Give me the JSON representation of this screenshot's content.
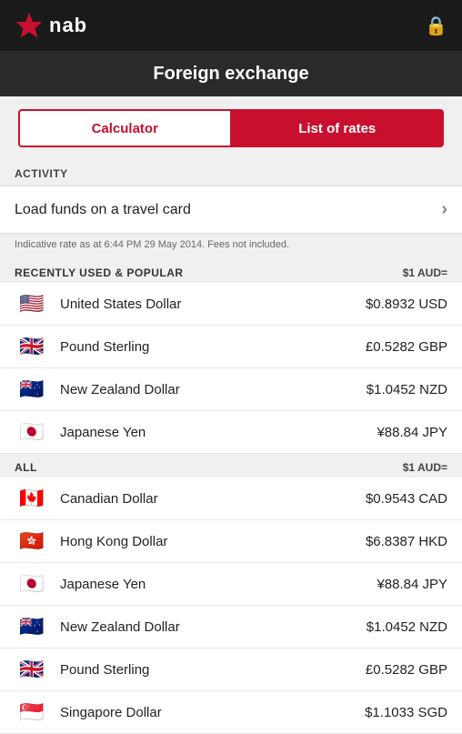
{
  "header": {
    "logo_text": "nab",
    "lock_icon": "🔒"
  },
  "title_bar": {
    "title": "Foreign exchange"
  },
  "tabs": {
    "calculator_label": "Calculator",
    "list_of_rates_label": "List of rates"
  },
  "activity": {
    "section_label": "ACTIVITY",
    "row_text": "Load funds on a travel card"
  },
  "indicative_note": "Indicative rate as at 6:44 PM 29 May 2014. Fees not included.",
  "recently_used": {
    "section_title": "RECENTLY USED & POPULAR",
    "rate_label": "$1 AUD=",
    "currencies": [
      {
        "flag": "🇺🇸",
        "name": "United States Dollar",
        "value": "$0.8932  USD"
      },
      {
        "flag": "🇬🇧",
        "name": "Pound Sterling",
        "value": "£0.5282  GBP"
      },
      {
        "flag": "🇳🇿",
        "name": "New Zealand Dollar",
        "value": "$1.0452  NZD"
      },
      {
        "flag": "🇯🇵",
        "name": "Japanese Yen",
        "value": "¥88.84  JPY"
      }
    ]
  },
  "all": {
    "section_title": "ALL",
    "rate_label": "$1 AUD=",
    "currencies": [
      {
        "flag": "🇨🇦",
        "name": "Canadian Dollar",
        "value": "$0.9543  CAD"
      },
      {
        "flag": "🇭🇰",
        "name": "Hong Kong Dollar",
        "value": "$6.8387  HKD"
      },
      {
        "flag": "🇯🇵",
        "name": "Japanese Yen",
        "value": "¥88.84  JPY"
      },
      {
        "flag": "🇳🇿",
        "name": "New Zealand Dollar",
        "value": "$1.0452  NZD"
      },
      {
        "flag": "🇬🇧",
        "name": "Pound Sterling",
        "value": "£0.5282  GBP"
      },
      {
        "flag": "🇸🇬",
        "name": "Singapore Dollar",
        "value": "$1.1033  SGD"
      }
    ]
  }
}
